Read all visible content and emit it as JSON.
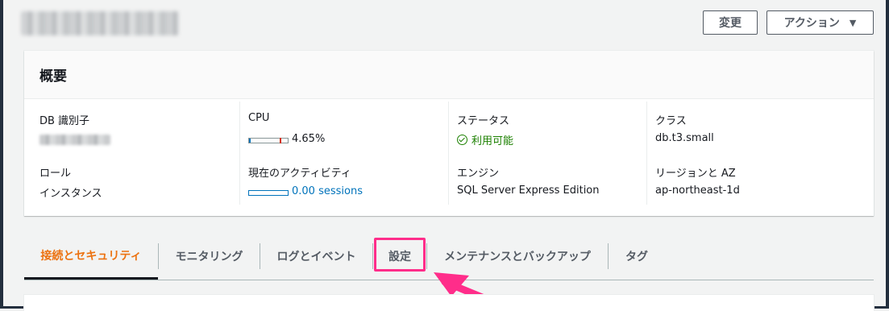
{
  "header": {
    "change_label": "変更",
    "actions_label": "アクション",
    "actions_caret": "▼"
  },
  "summary": {
    "title": "概要",
    "db_identifier_label": "DB 識別子",
    "cpu_label": "CPU",
    "cpu_value": "4.65%",
    "cpu_percent": 4.65,
    "status_label": "ステータス",
    "status_value": "利用可能",
    "class_label": "クラス",
    "class_value": "db.t3.small",
    "role_label": "ロール",
    "role_value": "インスタンス",
    "activity_label": "現在のアクティビティ",
    "activity_value": "0.00 sessions",
    "activity_sessions": 0.0,
    "engine_label": "エンジン",
    "engine_value": "SQL Server Express Edition",
    "region_label": "リージョンと AZ",
    "region_value": "ap-northeast-1d"
  },
  "tabs": [
    {
      "label": "接続とセキュリティ",
      "active": true
    },
    {
      "label": "モニタリング",
      "active": false
    },
    {
      "label": "ログとイベント",
      "active": false
    },
    {
      "label": "設定",
      "active": false,
      "highlighted": true
    },
    {
      "label": "メンテナンスとバックアップ",
      "active": false
    },
    {
      "label": "タグ",
      "active": false
    }
  ],
  "colors": {
    "accent": "#ec7211",
    "link": "#0073bb",
    "success": "#1d8102",
    "annotation": "#ff2d8a"
  },
  "icons": {
    "status": "check-circle-icon",
    "annotation": "arrow-icon"
  }
}
